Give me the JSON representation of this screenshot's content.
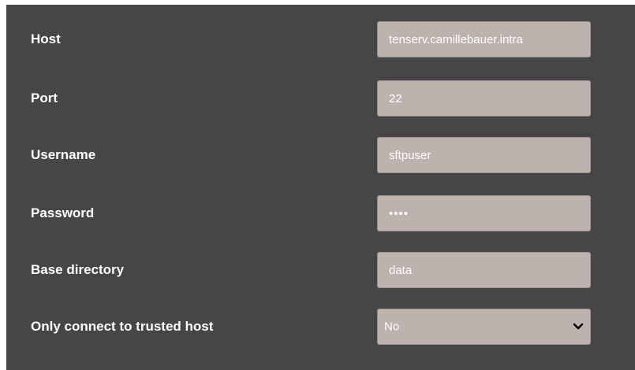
{
  "form": {
    "rows": [
      {
        "label": "Host",
        "value": "tenserv.camillebauer.intra"
      },
      {
        "label": "Port",
        "value": "22"
      },
      {
        "label": "Username",
        "value": "sftpuser"
      },
      {
        "label": "Password",
        "value": "••••"
      },
      {
        "label": "Base directory",
        "value": "data"
      },
      {
        "label": "Only connect to trusted host",
        "value": "No"
      }
    ]
  },
  "icons": {
    "select_arrow": "chevron-down-icon"
  },
  "colors": {
    "panel_bg": "#464646",
    "field_bg": "#bdb2ad",
    "text": "#ffffff"
  }
}
